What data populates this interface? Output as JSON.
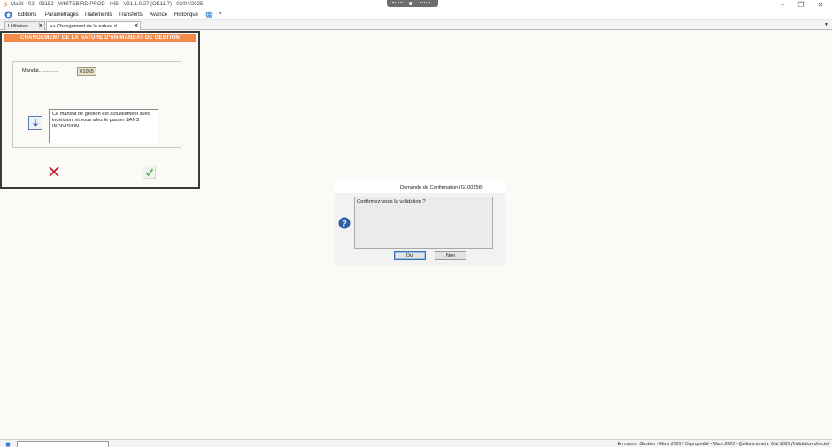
{
  "window": {
    "title": "MaGI - 02 - 03152 - WHITEBIRD PROD - INS - V21.1.0.27 (OE11.7) - 02/04/2025",
    "controls": {
      "minimize": "–",
      "restore": "❐",
      "close": "✕"
    }
  },
  "menu": {
    "items": [
      "Editions",
      "Paramétrages",
      "Traitements",
      "Transferts",
      "Avancé",
      "Historique"
    ],
    "help": "?"
  },
  "tabs": [
    {
      "label": "Utilitaires",
      "close": "✕",
      "active": false
    },
    {
      "label": ">> Changement de la nature d...",
      "close": "✕",
      "active": true
    }
  ],
  "tab_menu": "▼",
  "mandat_window": {
    "header": "CHANGEMENT DE LA NATURE D'UN MANDAT DE GESTION",
    "mandat_label": "Mandat..............",
    "mandat_value": "01055",
    "info_text": "Ce mandat de gestion est actuellement avec indivision, et vous allez le passer SANS INDIVISION."
  },
  "dialog": {
    "title": "Demande de Confirmation   (G100256)",
    "message": "Confirmez-vous la validation ?",
    "yes": "Oui",
    "no": "Non"
  },
  "status": {
    "text": "En cours : Gestion - Mars 2025   /   Copropriété - Mars 2025 - Quittancement: Mai 2025 (Validation directe)"
  },
  "colors": {
    "header_orange": "#f28a4a",
    "cancel_red": "#c8102e",
    "ok_green": "#4caf50",
    "help_blue": "#2b5fa8",
    "app_logo": "#f07a1a"
  },
  "icons": [
    "app-logo-icon",
    "home-icon",
    "globe-icon",
    "arrow-down-icon",
    "cancel-icon",
    "check-icon",
    "help-icon",
    "status-icon"
  ]
}
